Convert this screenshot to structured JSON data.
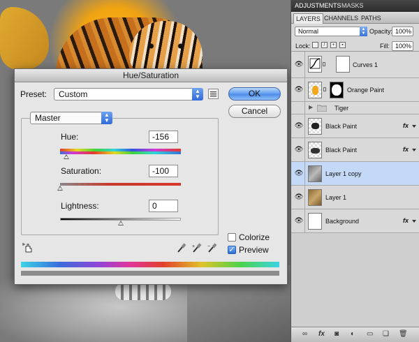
{
  "dialog": {
    "title": "Hue/Saturation",
    "preset_label": "Preset:",
    "preset_value": "Custom",
    "ok_label": "OK",
    "cancel_label": "Cancel",
    "channel_value": "Master",
    "hue_label": "Hue:",
    "hue_value": "-156",
    "saturation_label": "Saturation:",
    "saturation_value": "-100",
    "lightness_label": "Lightness:",
    "lightness_value": "0",
    "colorize_label": "Colorize",
    "colorize_checked": false,
    "preview_label": "Preview",
    "preview_checked": true,
    "hue_slider_pct": 0.05,
    "saturation_slider_pct": 0.0,
    "lightness_slider_pct": 0.5
  },
  "panel": {
    "top_tabs": [
      "ADJUSTMENTS",
      "MASKS"
    ],
    "tabs": [
      "LAYERS",
      "CHANNELS",
      "PATHS"
    ],
    "blend_mode": "Normal",
    "opacity_label": "Opacity:",
    "opacity_value": "100%",
    "lock_label": "Lock:",
    "fill_label": "Fill:",
    "fill_value": "100%",
    "layers": [
      {
        "name": "Curves 1",
        "fx": false,
        "selected": false
      },
      {
        "name": "Orange Paint",
        "fx": false,
        "selected": false
      },
      {
        "name": "Tiger",
        "fx": false,
        "selected": false
      },
      {
        "name": "Black Paint",
        "fx": true,
        "selected": false
      },
      {
        "name": "Black Paint",
        "fx": true,
        "selected": false
      },
      {
        "name": "Layer 1 copy",
        "fx": false,
        "selected": true
      },
      {
        "name": "Layer 1",
        "fx": false,
        "selected": false
      },
      {
        "name": "Background",
        "fx": true,
        "selected": false
      }
    ],
    "fx_symbol": "fx"
  },
  "icons": {
    "eye": "eye-icon",
    "folder": "folder-icon",
    "eyedropper": "eyedropper-icon",
    "targeted-adjustment": "hand-icon",
    "menu": "menu-icon"
  }
}
